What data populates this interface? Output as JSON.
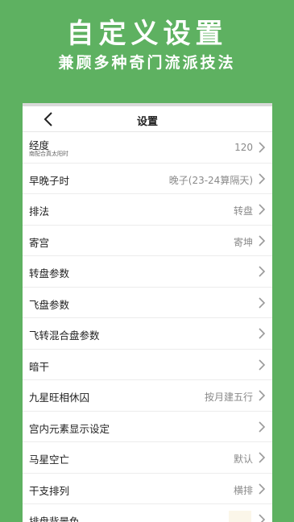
{
  "banner": {
    "title": "自定义设置",
    "subtitle": "兼顾多种奇门流派技法"
  },
  "navbar": {
    "title": "设置",
    "back_icon": "chevron-left-icon"
  },
  "colors": {
    "background": "#5eb161",
    "card": "#ffffff",
    "label": "#222222",
    "value": "#8a8a8a",
    "chevron": "#9a9a9a"
  },
  "settings": [
    {
      "label": "经度",
      "sub": "南配合真太阳时",
      "value": "120"
    },
    {
      "label": "早晚子时",
      "value": "晚子(23-24算隔天)"
    },
    {
      "label": "排法",
      "value": "转盘"
    },
    {
      "label": "寄宫",
      "value": "寄坤"
    },
    {
      "label": "转盘参数",
      "value": ""
    },
    {
      "label": "飞盘参数",
      "value": ""
    },
    {
      "label": "飞转混合盘参数",
      "value": ""
    },
    {
      "label": "暗干",
      "value": ""
    },
    {
      "label": "九星旺相休囚",
      "value": "按月建五行"
    },
    {
      "label": "宫内元素显示设定",
      "value": ""
    },
    {
      "label": "马星空亡",
      "value": "默认"
    },
    {
      "label": "干支排列",
      "value": "横排"
    },
    {
      "label": "排盘背景色",
      "value": "",
      "swatch": "#fbf6e9"
    }
  ]
}
